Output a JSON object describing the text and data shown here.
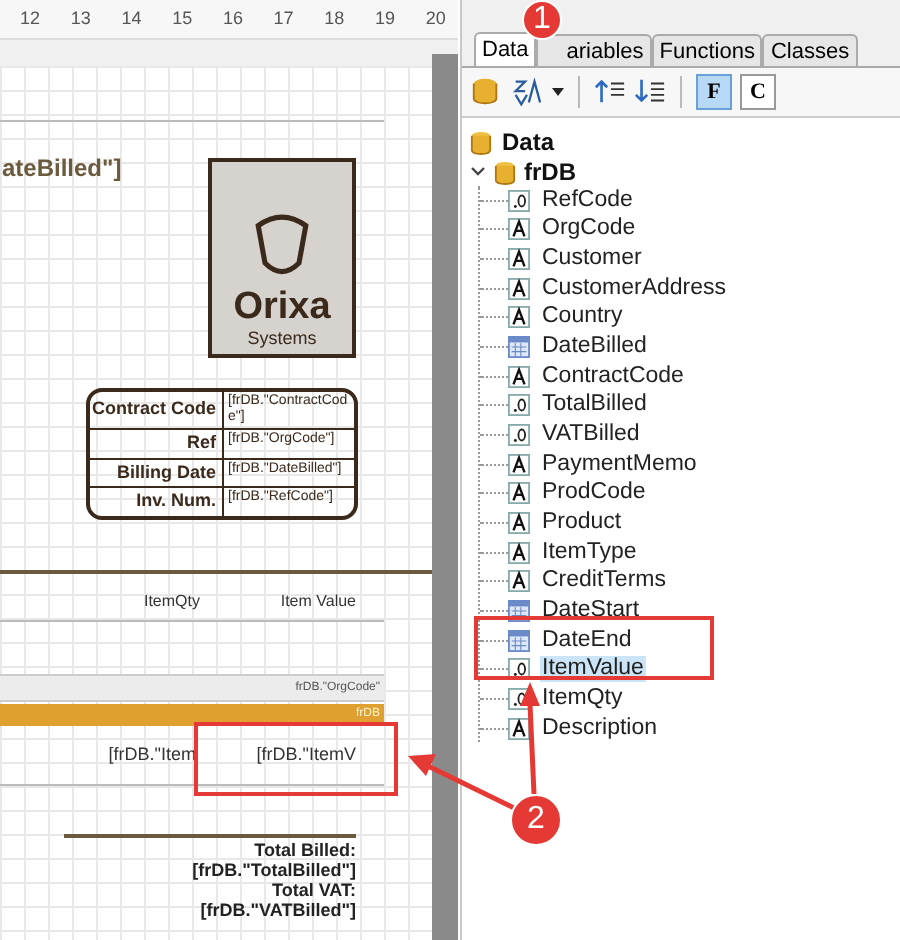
{
  "ruler": {
    "ticks": [
      "12",
      "13",
      "14",
      "15",
      "16",
      "17",
      "18",
      "19",
      "20"
    ]
  },
  "report": {
    "header_field": "ateBilled\"]",
    "logo": {
      "name": "Orixa",
      "tagline": "Systems"
    },
    "info_table": [
      {
        "label": "Contract Code",
        "value": "[frDB.\"ContractCode\"]"
      },
      {
        "label": "Ref",
        "value": "[frDB.\"OrgCode\"]"
      },
      {
        "label": "Billing Date",
        "value": "[frDB.\"DateBilled\"]"
      },
      {
        "label": "Inv. Num.",
        "value": "[frDB.\"RefCode\"]"
      }
    ],
    "column_headers": [
      "ItemQty",
      "Item Value"
    ],
    "group_header": "frDB.\"OrgCode\"",
    "data_band": "frDB",
    "data_cells": [
      "[frDB.\"Item",
      "[frDB.\"ItemV"
    ],
    "totals": [
      "Total Billed:",
      "[frDB.\"TotalBilled\"]",
      "Total VAT:",
      "[frDB.\"VATBilled\"]"
    ]
  },
  "tabs": [
    {
      "label": "Data",
      "selected": true
    },
    {
      "label": "ariables",
      "selected": false
    },
    {
      "label": "Functions",
      "selected": false
    },
    {
      "label": "Classes",
      "selected": false
    }
  ],
  "toolbar": [
    {
      "kind": "database",
      "selected": false
    },
    {
      "kind": "sort",
      "selected": false
    },
    {
      "kind": "separator"
    },
    {
      "kind": "expand",
      "selected": false
    },
    {
      "kind": "collapse",
      "selected": false
    },
    {
      "kind": "separator"
    },
    {
      "kind": "fields",
      "label": "F",
      "selected": true
    },
    {
      "kind": "class",
      "label": "C",
      "selected": false
    }
  ],
  "tree": [
    {
      "label": "Data",
      "kind": "root",
      "children": [
        {
          "label": "frDB",
          "kind": "dataset",
          "expanded": true,
          "children": [
            {
              "label": "RefCode",
              "kind": "number",
              "selected": false
            },
            {
              "label": "OrgCode",
              "kind": "string",
              "selected": false
            },
            {
              "label": "Customer",
              "kind": "string",
              "selected": false
            },
            {
              "label": "CustomerAddress",
              "kind": "string",
              "selected": false
            },
            {
              "label": "Country",
              "kind": "string",
              "selected": false
            },
            {
              "label": "DateBilled",
              "kind": "date",
              "selected": false
            },
            {
              "label": "ContractCode",
              "kind": "string",
              "selected": false
            },
            {
              "label": "TotalBilled",
              "kind": "number",
              "selected": false
            },
            {
              "label": "VATBilled",
              "kind": "number",
              "selected": false
            },
            {
              "label": "PaymentMemo",
              "kind": "string",
              "selected": false
            },
            {
              "label": "ProdCode",
              "kind": "string",
              "selected": false
            },
            {
              "label": "Product",
              "kind": "string",
              "selected": false
            },
            {
              "label": "ItemType",
              "kind": "string",
              "selected": false
            },
            {
              "label": "CreditTerms",
              "kind": "string",
              "selected": false
            },
            {
              "label": "DateStart",
              "kind": "date",
              "selected": false
            },
            {
              "label": "DateEnd",
              "kind": "date",
              "selected": false
            },
            {
              "label": "ItemValue",
              "kind": "number",
              "selected": true
            },
            {
              "label": "ItemQty",
              "kind": "number",
              "selected": false
            },
            {
              "label": "Description",
              "kind": "string",
              "selected": false
            }
          ]
        }
      ]
    }
  ],
  "callouts": [
    "1",
    "2"
  ]
}
